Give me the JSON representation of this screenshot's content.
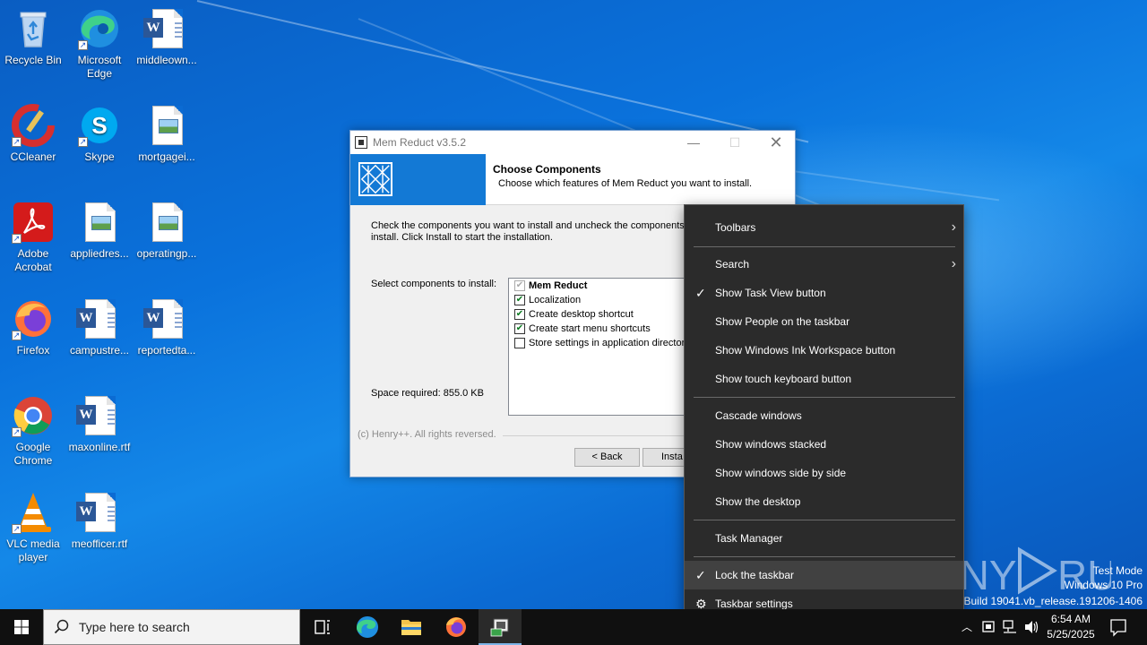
{
  "desktop": {
    "icons": [
      {
        "label": "Recycle Bin",
        "icon": "recycle-bin-icon"
      },
      {
        "label": "Microsoft Edge",
        "icon": "edge-icon"
      },
      {
        "label": "middleown...",
        "icon": "word-document-icon"
      },
      {
        "label": "CCleaner",
        "icon": "ccleaner-icon"
      },
      {
        "label": "Skype",
        "icon": "skype-icon"
      },
      {
        "label": "mortgagei...",
        "icon": "image-file-icon"
      },
      {
        "label": "Adobe Acrobat",
        "icon": "acrobat-icon"
      },
      {
        "label": "appliedres...",
        "icon": "image-file-icon"
      },
      {
        "label": "operatingp...",
        "icon": "image-file-icon"
      },
      {
        "label": "Firefox",
        "icon": "firefox-icon"
      },
      {
        "label": "campustre...",
        "icon": "word-document-icon"
      },
      {
        "label": "reportedta...",
        "icon": "word-document-icon"
      },
      {
        "label": "Google Chrome",
        "icon": "chrome-icon"
      },
      {
        "label": "maxonline.rtf",
        "icon": "word-document-icon"
      },
      {
        "label": "VLC media player",
        "icon": "vlc-icon"
      },
      {
        "label": "meofficer.rtf",
        "icon": "word-document-icon"
      }
    ]
  },
  "installer": {
    "title": "Mem Reduct v3.5.2",
    "header_title": "Choose Components",
    "header_subtitle": "Choose which features of Mem Reduct you want to install.",
    "instructions": "Check the components you want to install and uncheck the components y install. Click Install to start the installation.",
    "select_label": "Select components to install:",
    "space_required": "Space required: 855.0 KB",
    "components": [
      {
        "label": "Mem Reduct",
        "checked": true,
        "disabled": true
      },
      {
        "label": "Localization",
        "checked": true,
        "disabled": false
      },
      {
        "label": "Create desktop shortcut",
        "checked": true,
        "disabled": false
      },
      {
        "label": "Create start menu shortcuts",
        "checked": true,
        "disabled": false
      },
      {
        "label": "Store settings in application directory",
        "checked": false,
        "disabled": false
      }
    ],
    "copyright": "(c) Henry++. All rights reversed.",
    "back_label": "< Back",
    "install_label": "Insta"
  },
  "context_menu": {
    "items": [
      {
        "label": "Toolbars",
        "submenu": true,
        "checked": false
      },
      {
        "label": "Search",
        "submenu": true,
        "checked": false
      },
      {
        "label": "Show Task View button",
        "submenu": false,
        "checked": true
      },
      {
        "label": "Show People on the taskbar",
        "submenu": false,
        "checked": false
      },
      {
        "label": "Show Windows Ink Workspace button",
        "submenu": false,
        "checked": false
      },
      {
        "label": "Show touch keyboard button",
        "submenu": false,
        "checked": false
      },
      {
        "label": "Cascade windows",
        "submenu": false,
        "checked": false
      },
      {
        "label": "Show windows stacked",
        "submenu": false,
        "checked": false
      },
      {
        "label": "Show windows side by side",
        "submenu": false,
        "checked": false
      },
      {
        "label": "Show the desktop",
        "submenu": false,
        "checked": false
      },
      {
        "label": "Task Manager",
        "submenu": false,
        "checked": false
      },
      {
        "label": "Lock the taskbar",
        "submenu": false,
        "checked": true,
        "highlighted": true
      },
      {
        "label": "Taskbar settings",
        "submenu": false,
        "checked": false,
        "gear": true
      }
    ]
  },
  "watermark": {
    "brand": "ANY RUN",
    "mode": "Test Mode",
    "edition": "Windows 10 Pro",
    "build": "Build 19041.vb_release.191206-1406"
  },
  "taskbar": {
    "search_placeholder": "Type here to search",
    "time": "6:54 AM",
    "date": "5/25/2025"
  },
  "colors": {
    "desktop_blue": "#0b6fd6",
    "installer_banner": "#1379d5",
    "menu_bg": "#2b2b2b",
    "taskbar_bg": "#101010"
  }
}
